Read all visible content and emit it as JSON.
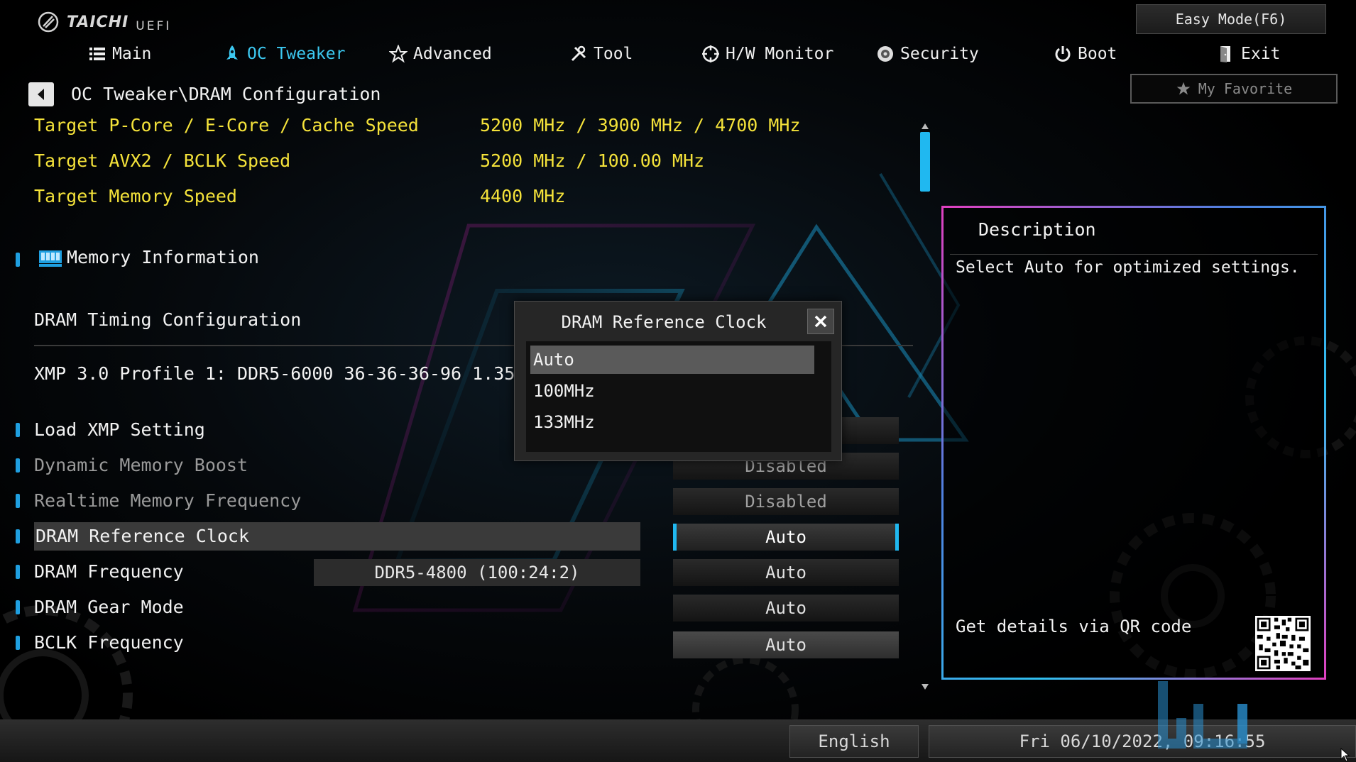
{
  "brand": {
    "name": "TAICHI",
    "subtitle": "UEFI"
  },
  "header": {
    "easy_mode_label": "Easy Mode(F6)",
    "favorite_label": "My Favorite"
  },
  "nav": [
    {
      "label": "Main",
      "icon": "list-icon"
    },
    {
      "label": "OC Tweaker",
      "icon": "rocket-icon",
      "active": true
    },
    {
      "label": "Advanced",
      "icon": "star-icon"
    },
    {
      "label": "Tool",
      "icon": "tools-icon"
    },
    {
      "label": "H/W Monitor",
      "icon": "crosshair-icon"
    },
    {
      "label": "Security",
      "icon": "shield-icon"
    },
    {
      "label": "Boot",
      "icon": "power-icon"
    },
    {
      "label": "Exit",
      "icon": "exit-door-icon"
    }
  ],
  "breadcrumb": "OC Tweaker\\DRAM Configuration",
  "summary": [
    {
      "label": "Target P-Core / E-Core / Cache Speed",
      "value": "5200 MHz / 3900 MHz / 4700 MHz"
    },
    {
      "label": "Target AVX2 / BCLK Speed",
      "value": "5200 MHz / 100.00 MHz"
    },
    {
      "label": "Target Memory Speed",
      "value": "4400 MHz"
    }
  ],
  "memory_information_label": "Memory Information",
  "dram_timing_label": "DRAM Timing Configuration",
  "xmp_profile_text": "XMP 3.0 Profile 1: DDR5-6000 36-36-36-96 1.35V 1DPC",
  "settings": [
    {
      "label": "Load XMP Setting",
      "value": ""
    },
    {
      "label": "Dynamic Memory Boost",
      "value": "Disabled"
    },
    {
      "label": "Realtime Memory Frequency",
      "value": "Disabled"
    },
    {
      "label": "DRAM Reference Clock",
      "value": "Auto"
    },
    {
      "label": "DRAM Frequency",
      "value": "Auto",
      "readout": "DDR5-4800 (100:24:2)"
    },
    {
      "label": "DRAM Gear Mode",
      "value": "Auto"
    },
    {
      "label": "BCLK Frequency",
      "value": "Auto"
    }
  ],
  "description": {
    "title": "Description",
    "text": "Select Auto for optimized settings.",
    "qr_label": "Get details via QR code"
  },
  "popup": {
    "title": "DRAM Reference Clock",
    "options": [
      "Auto",
      "100MHz",
      "133MHz"
    ],
    "selected_index": 0
  },
  "status_bar": {
    "language": "English",
    "datetime": "Fri 06/10/2022, 09:16:55"
  },
  "colors": {
    "accent": "#20b8f0",
    "highlight_text": "#f4e23a",
    "panel_border_pink": "#e040c0",
    "panel_border_blue": "#30c0f0"
  }
}
